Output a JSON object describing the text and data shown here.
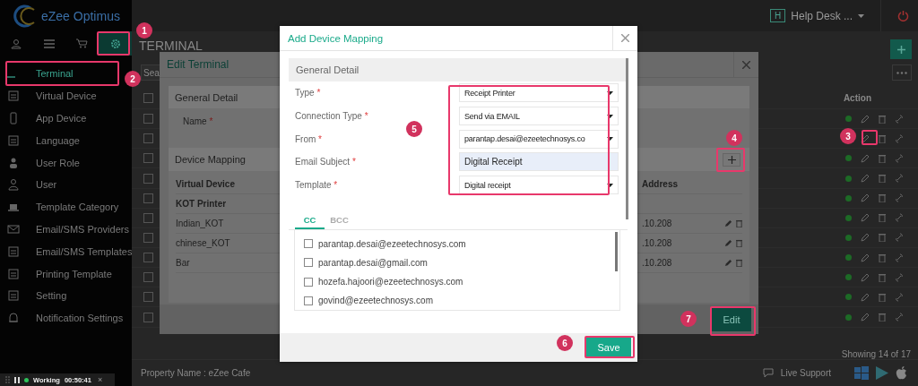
{
  "app": {
    "logo": "eZee Optimus",
    "help_badge": "H",
    "help_desk": "Help Desk ..."
  },
  "sidebar": {
    "tabs": [
      {
        "selected": false
      },
      {
        "selected": false
      },
      {
        "selected": false
      },
      {
        "selected": true
      }
    ],
    "items": [
      {
        "label": "Terminal",
        "selected": true
      },
      {
        "label": "Virtual Device",
        "selected": false
      },
      {
        "label": "App Device",
        "selected": false
      },
      {
        "label": "Language",
        "selected": false
      },
      {
        "label": "User Role",
        "selected": false
      },
      {
        "label": "User",
        "selected": false
      },
      {
        "label": "Template Category",
        "selected": false
      },
      {
        "label": "Email/SMS Providers",
        "selected": false
      },
      {
        "label": "Email/SMS Templates",
        "selected": false
      },
      {
        "label": "Printing Template",
        "selected": false
      },
      {
        "label": "Setting",
        "selected": false
      },
      {
        "label": "Notification Settings",
        "selected": false
      }
    ]
  },
  "page": {
    "title": "TERMINAL",
    "search_placeholder": "Sea",
    "action_header": "Action",
    "select_all_checked": false,
    "rows": [
      {
        "checked": false
      },
      {
        "checked": false
      },
      {
        "checked": false
      },
      {
        "checked": false
      },
      {
        "checked": false
      },
      {
        "checked": false
      },
      {
        "checked": false
      },
      {
        "checked": false
      },
      {
        "checked": false
      },
      {
        "checked": false
      },
      {
        "checked": false
      }
    ],
    "showing": "Showing 14 of 17",
    "property": "Property Name : eZee Cafe",
    "live_support": "Live Support"
  },
  "edit_terminal": {
    "title": "Edit Terminal",
    "general_section": "General Detail",
    "name_label": "Name",
    "name_required": "*",
    "mapping_section": "Device Mapping",
    "columns": [
      "Virtual Device",
      "Address"
    ],
    "rows": [
      {
        "kind": "group",
        "device": "KOT Printer"
      },
      {
        "kind": "item",
        "device": "Indian_KOT",
        "address": ".10.208"
      },
      {
        "kind": "item",
        "device": "chinese_KOT",
        "address": ".10.208"
      },
      {
        "kind": "item",
        "device": "Bar",
        "address": ".10.208"
      }
    ],
    "edit_button": "Edit"
  },
  "add_mapping": {
    "title": "Add Device Mapping",
    "section": "General Detail",
    "fields": [
      {
        "label": "Type",
        "required": "*",
        "kind": "select",
        "value": "Receipt Printer"
      },
      {
        "label": "Connection Type",
        "required": "*",
        "kind": "select",
        "value": "Send via EMAIL"
      },
      {
        "label": "From",
        "required": "*",
        "kind": "select",
        "value": "parantap.desai@ezeetechnosys.co"
      },
      {
        "label": "Email Subject",
        "required": "*",
        "kind": "input",
        "value": "Digital Receipt"
      },
      {
        "label": "Template",
        "required": "*",
        "kind": "select",
        "value": "Digital receipt"
      }
    ],
    "tabs": [
      {
        "label": "CC",
        "selected": true
      },
      {
        "label": "BCC",
        "selected": false
      }
    ],
    "emails": [
      {
        "address": "parantap.desai@ezeetechnosys.com",
        "checked": false
      },
      {
        "address": "parantap.desai@gmail.com",
        "checked": false
      },
      {
        "address": "hozefa.hajoori@ezeetechnosys.com",
        "checked": false
      },
      {
        "address": "govind@ezeetechnosys.com",
        "checked": false
      }
    ],
    "save_button": "Save"
  },
  "annotations": [
    {
      "number": "1"
    },
    {
      "number": "2"
    },
    {
      "number": "3"
    },
    {
      "number": "4"
    },
    {
      "number": "5"
    },
    {
      "number": "6"
    },
    {
      "number": "7"
    }
  ],
  "timer": {
    "status": "Working",
    "time": "00:50:41",
    "close": "×"
  }
}
